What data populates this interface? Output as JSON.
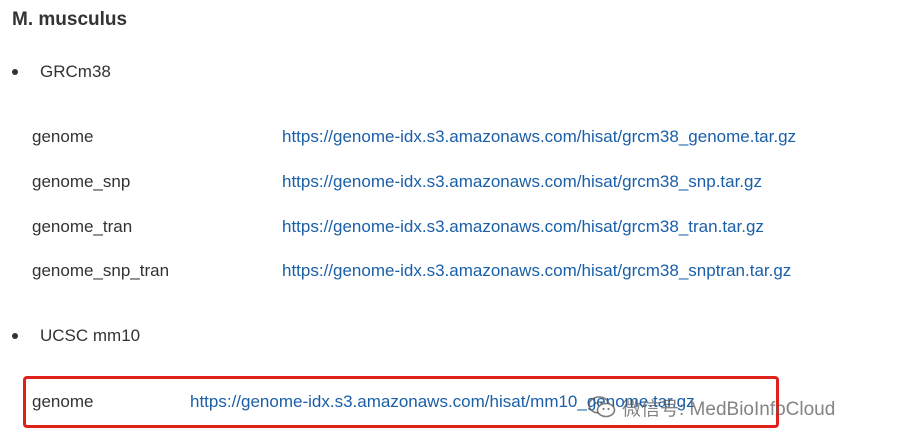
{
  "title": "M. musculus",
  "sections": [
    {
      "label": "GRCm38",
      "rows": [
        {
          "name": "genome",
          "url": "https://genome-idx.s3.amazonaws.com/hisat/grcm38_genome.tar.gz"
        },
        {
          "name": "genome_snp",
          "url": "https://genome-idx.s3.amazonaws.com/hisat/grcm38_snp.tar.gz"
        },
        {
          "name": "genome_tran",
          "url": "https://genome-idx.s3.amazonaws.com/hisat/grcm38_tran.tar.gz"
        },
        {
          "name": "genome_snp_tran",
          "url": "https://genome-idx.s3.amazonaws.com/hisat/grcm38_snptran.tar.gz"
        }
      ]
    },
    {
      "label": "UCSC mm10",
      "rows": [
        {
          "name": "genome",
          "url": "https://genome-idx.s3.amazonaws.com/hisat/mm10_genome.tar.gz"
        }
      ]
    }
  ],
  "watermark": {
    "text": "微信号: MedBioInfoCloud",
    "icon": "wechat-icon"
  },
  "colors": {
    "text": "#333333",
    "link": "#1a5fa8",
    "highlight": "#e0201a"
  }
}
